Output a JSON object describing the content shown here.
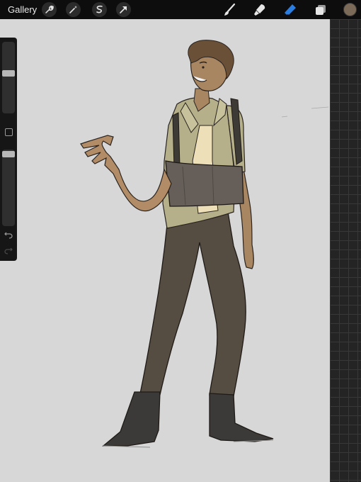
{
  "topbar": {
    "gallery_label": "Gallery",
    "left_tools": [
      "wrench-icon",
      "magic-wand-icon",
      "selection-icon",
      "transform-arrow-icon"
    ],
    "right_tools": [
      "brush-icon",
      "smudge-icon",
      "eraser-icon",
      "layers-icon"
    ],
    "active_tool": "eraser-icon",
    "current_color": "#7a6a57"
  },
  "sidebar": {
    "controls": [
      "brush-size-slider",
      "modify-button",
      "opacity-slider",
      "undo-button",
      "redo-button"
    ]
  },
  "colors": {
    "accent": "#2a7de1",
    "canvas_bg": "#d7d7d7"
  }
}
